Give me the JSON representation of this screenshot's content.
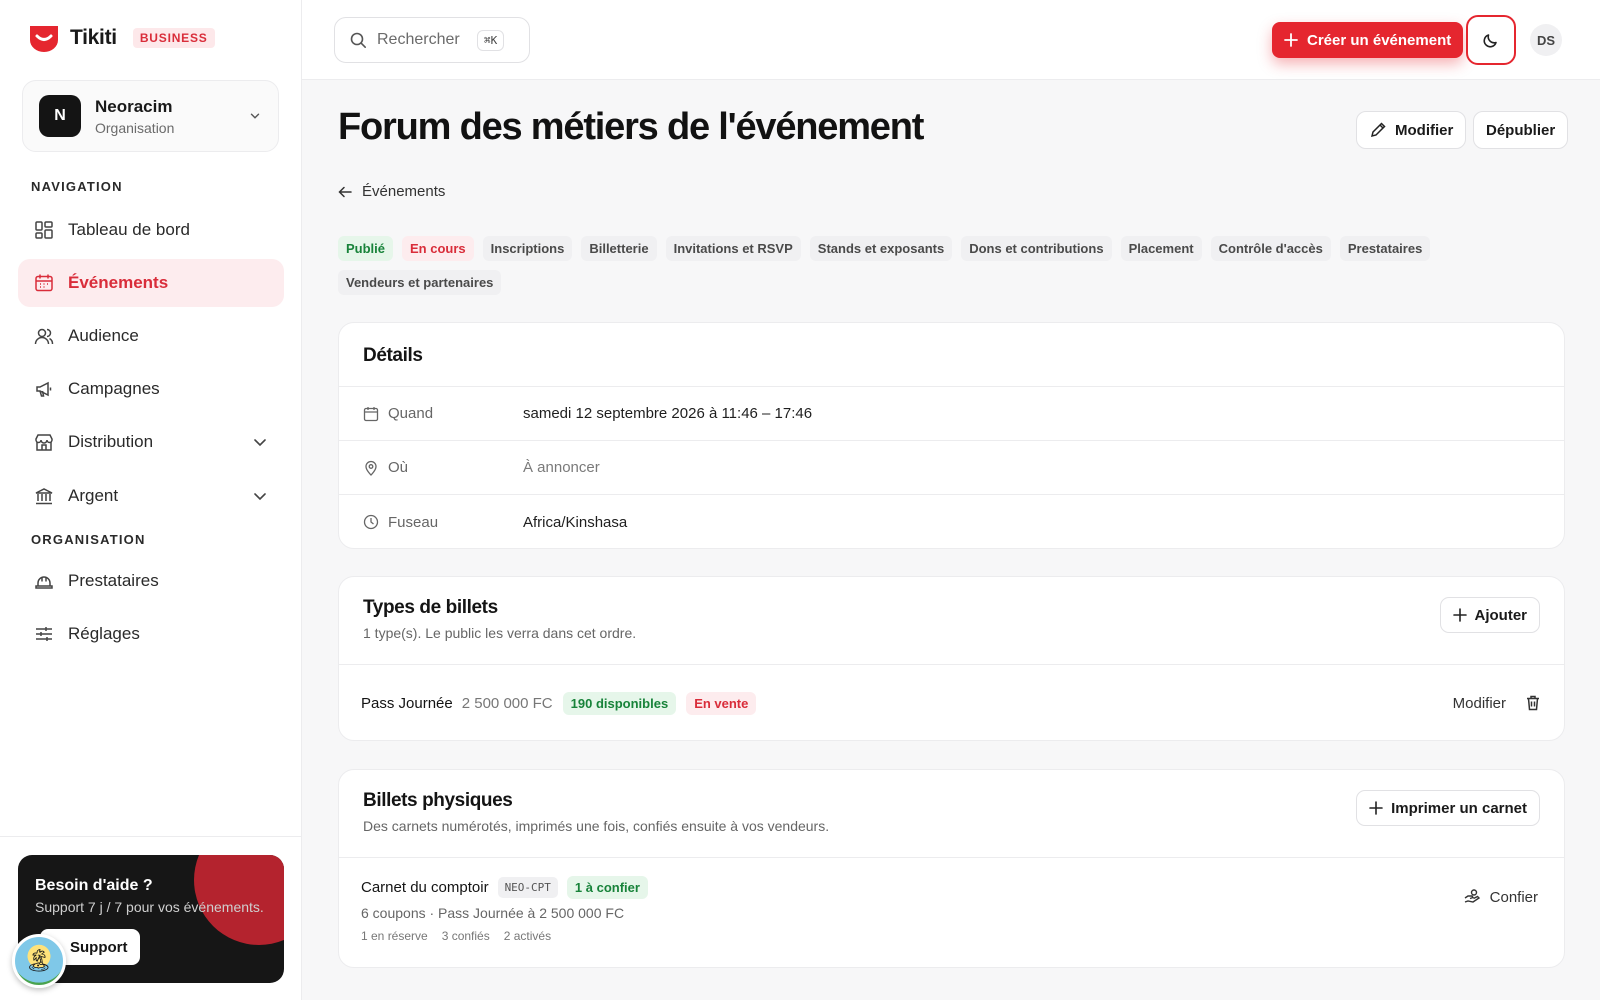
{
  "brand": {
    "name": "Tikiti",
    "badge": "BUSINESS"
  },
  "org": {
    "initial": "N",
    "name": "Neoracim",
    "type": "Organisation"
  },
  "nav": {
    "section_navigation": "NAVIGATION",
    "section_organisation": "ORGANISATION",
    "items": [
      {
        "label": "Tableau de bord"
      },
      {
        "label": "Événements"
      },
      {
        "label": "Audience"
      },
      {
        "label": "Campagnes"
      },
      {
        "label": "Distribution"
      },
      {
        "label": "Argent"
      },
      {
        "label": "Prestataires"
      },
      {
        "label": "Réglages"
      }
    ]
  },
  "help": {
    "title": "Besoin d'aide ?",
    "subtitle": "Support 7 j / 7 pour vos événements.",
    "button": "Support"
  },
  "topbar": {
    "search_placeholder": "Rechercher",
    "shortcut": "⌘K",
    "create_label": "Créer un événement",
    "user_initials": "DS"
  },
  "header": {
    "title": "Forum des métiers de l'événement",
    "edit_label": "Modifier",
    "unpublish_label": "Dépublier",
    "back_label": "Événements"
  },
  "tags": [
    "Publié",
    "En cours",
    "Inscriptions",
    "Billetterie",
    "Invitations et RSVP",
    "Stands et exposants",
    "Dons et contributions",
    "Placement",
    "Contrôle d'accès",
    "Prestataires",
    "Vendeurs et partenaires"
  ],
  "colors": {
    "accent": "#e5262f",
    "success": "#18833a"
  },
  "details": {
    "title": "Détails",
    "when_label": "Quand",
    "when_value": "samedi 12 septembre 2026 à 11:46 – 17:46",
    "where_label": "Où",
    "where_value": "À annoncer",
    "tz_label": "Fuseau",
    "tz_value": "Africa/Kinshasa"
  },
  "tickets": {
    "title": "Types de billets",
    "subtitle": "1 type(s). Le public les verra dans cet ordre.",
    "add_label": "Ajouter",
    "items": [
      {
        "name": "Pass Journée",
        "price": "2 500 000 FC",
        "availability": "190 disponibles",
        "status": "En vente",
        "action": "Modifier"
      }
    ]
  },
  "physical": {
    "title": "Billets physiques",
    "subtitle": "Des carnets numérotés, imprimés une fois, confiés ensuite à vos vendeurs.",
    "add_label": "Imprimer un carnet",
    "items": [
      {
        "name": "Carnet du comptoir",
        "code": "NEO-CPT",
        "badge": "1 à confier",
        "summary": "6 coupons · Pass Journée à 2 500 000 FC",
        "reserved": "1 en réserve",
        "entrusted": "3 confiés",
        "activated": "2 activés",
        "action": "Confier"
      }
    ]
  }
}
